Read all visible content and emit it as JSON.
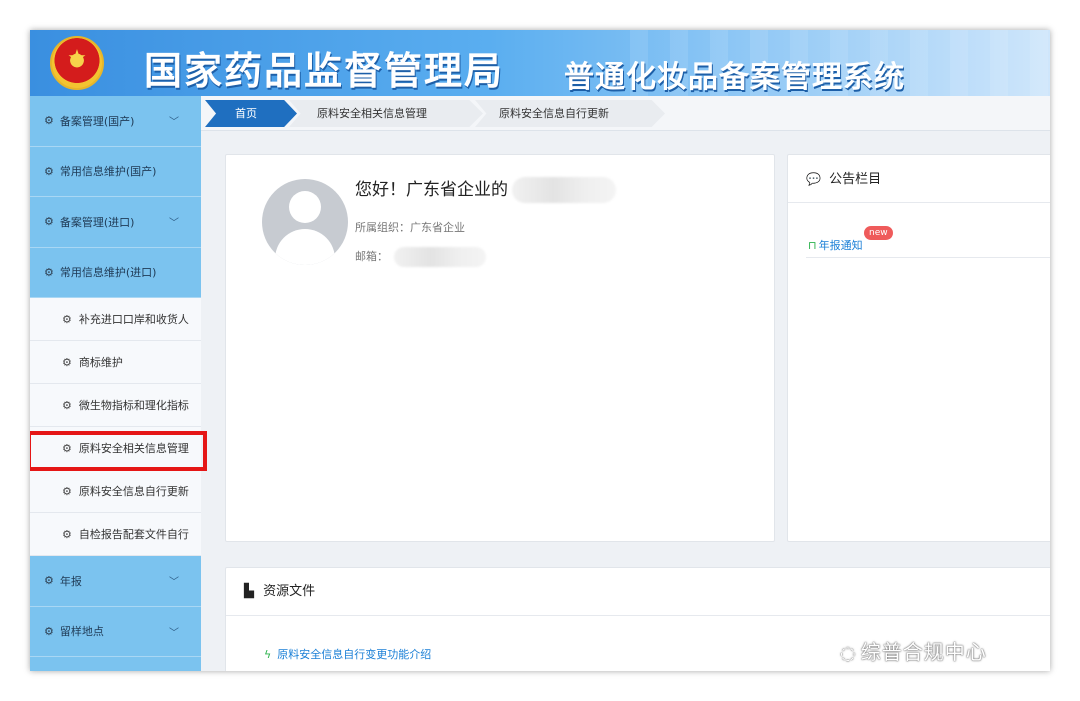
{
  "banner": {
    "title": "国家药品监督管理局",
    "subtitle": "普通化妆品备案管理系统"
  },
  "sidebar": {
    "items": [
      {
        "label": "备案管理(国产)",
        "chevron": true
      },
      {
        "label": "常用信息维护(国产)",
        "chevron": false
      },
      {
        "label": "备案管理(进口)",
        "chevron": true
      },
      {
        "label": "常用信息维护(进口)",
        "chevron": false
      }
    ],
    "sub_items": [
      {
        "label": "补充进口口岸和收货人"
      },
      {
        "label": "商标维护"
      },
      {
        "label": "微生物指标和理化指标"
      },
      {
        "label": "原料安全相关信息管理"
      },
      {
        "label": "原料安全信息自行更新"
      },
      {
        "label": "自检报告配套文件自行"
      }
    ],
    "bottom_items": [
      {
        "label": "年报",
        "chevron": true
      },
      {
        "label": "留样地点",
        "chevron": true
      }
    ],
    "gear_icon": "⚙",
    "chevron_icon": "﹀"
  },
  "breadcrumb": {
    "home": "首页",
    "level2": "原料安全相关信息管理",
    "level3": "原料安全信息自行更新"
  },
  "profile": {
    "greeting": "您好！广东省企业的",
    "org_label": "所属组织：广东省企业",
    "email_label": "邮箱："
  },
  "notice": {
    "title": "公告栏目",
    "link": "年报通知",
    "badge": "new"
  },
  "resources": {
    "title": "资源文件",
    "link": "原料安全信息自行变更功能介绍"
  },
  "watermark": {
    "text": "综普合规中心"
  },
  "colors": {
    "sidebar_bg": "#7bc3ef",
    "breadcrumb_active": "#1f6fc0",
    "highlight_box": "#e51616",
    "link": "#1a7fd6"
  }
}
